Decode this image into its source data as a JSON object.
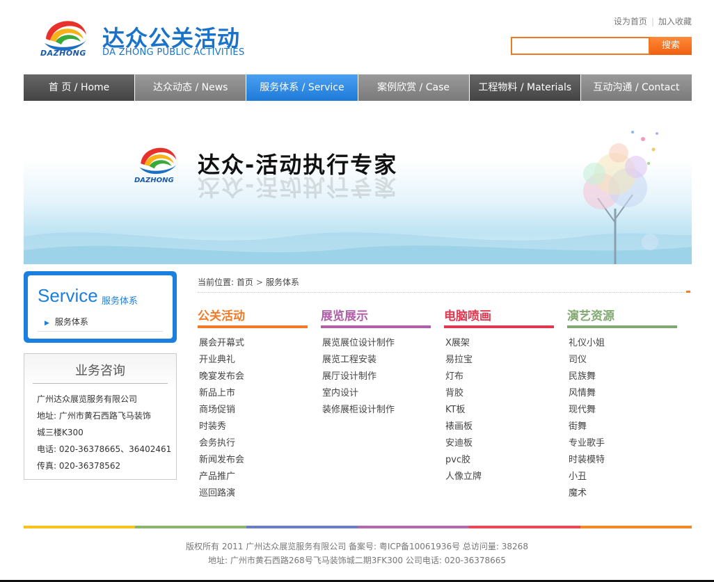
{
  "header": {
    "brand_cn": "达众公关活动",
    "brand_en": "DA ZHONG PUBLIC ACTIVITIES",
    "logo_text": "DAZHONG",
    "top_links": [
      "设为首页",
      "加入收藏"
    ],
    "search_value": "",
    "search_button": "搜索"
  },
  "nav": [
    {
      "label": "首 页 / Home",
      "state": "dark"
    },
    {
      "label": "达众动态 / News",
      "state": "normal"
    },
    {
      "label": "服务体系 / Service",
      "state": "active"
    },
    {
      "label": "案例欣赏 / Case",
      "state": "normal"
    },
    {
      "label": "工程物料 / Materials",
      "state": "dark"
    },
    {
      "label": "互动沟通 / Contact",
      "state": "normal"
    }
  ],
  "banner": {
    "logo_text": "DAZHONG",
    "title": "达众-活动执行专家"
  },
  "sidebar": {
    "title_en": "Service",
    "title_cn": "服务体系",
    "link": "服务体系"
  },
  "consult": {
    "title": "业务咨询",
    "company": "广州达众展览服务有限公司",
    "address_line1": "地址:  广州市黄石西路飞马装饰",
    "address_line2": "城三楼K300",
    "phone": "电话:  020-36378665、36402461",
    "fax": "传真:  020-36378562"
  },
  "breadcrumb": {
    "prefix": "当前位置: ",
    "home": "首页",
    "current": "服务体系"
  },
  "columns": [
    {
      "title": "公关活动",
      "color": "#f07a28",
      "items": [
        "展会开幕式",
        "开业典礼",
        "晚宴发布会",
        "新品上市",
        "商场促销",
        "时装秀",
        "会务执行",
        "新闻发布会",
        "产品推广",
        "巡回路演"
      ]
    },
    {
      "title": "展览展示",
      "color": "#b060a8",
      "items": [
        "展览展位设计制作",
        "展览工程安装",
        "展厅设计制作",
        "室内设计",
        "装修展柜设计制作"
      ]
    },
    {
      "title": "电脑喷画",
      "color": "#e03850",
      "items": [
        "X展架",
        "易拉宝",
        "灯布",
        "背胶",
        "KT板",
        "裱画板",
        "安迪板",
        "pvc胶",
        "人像立牌"
      ]
    },
    {
      "title": "演艺资源",
      "color": "#80a870",
      "items": [
        "礼仪小姐",
        "司仪",
        "民族舞",
        "风情舞",
        "现代舞",
        "街舞",
        "专业歌手",
        "时装模特",
        "小丑",
        "魔术"
      ]
    }
  ],
  "footer": {
    "line1": "版权所有 2011 广州达众展览服务有限公司    备案号: 粤ICP备10061936号    总访问量: 38268",
    "line2": "地址: 广州市黄石西路268号飞马装饰城二期3FK300    公司电话: 020-36378665",
    "bar_colors": [
      "#f5c21e",
      "#8db46e",
      "#6a7fc0",
      "#b06aa8",
      "#e84858",
      "#f08a28"
    ]
  }
}
